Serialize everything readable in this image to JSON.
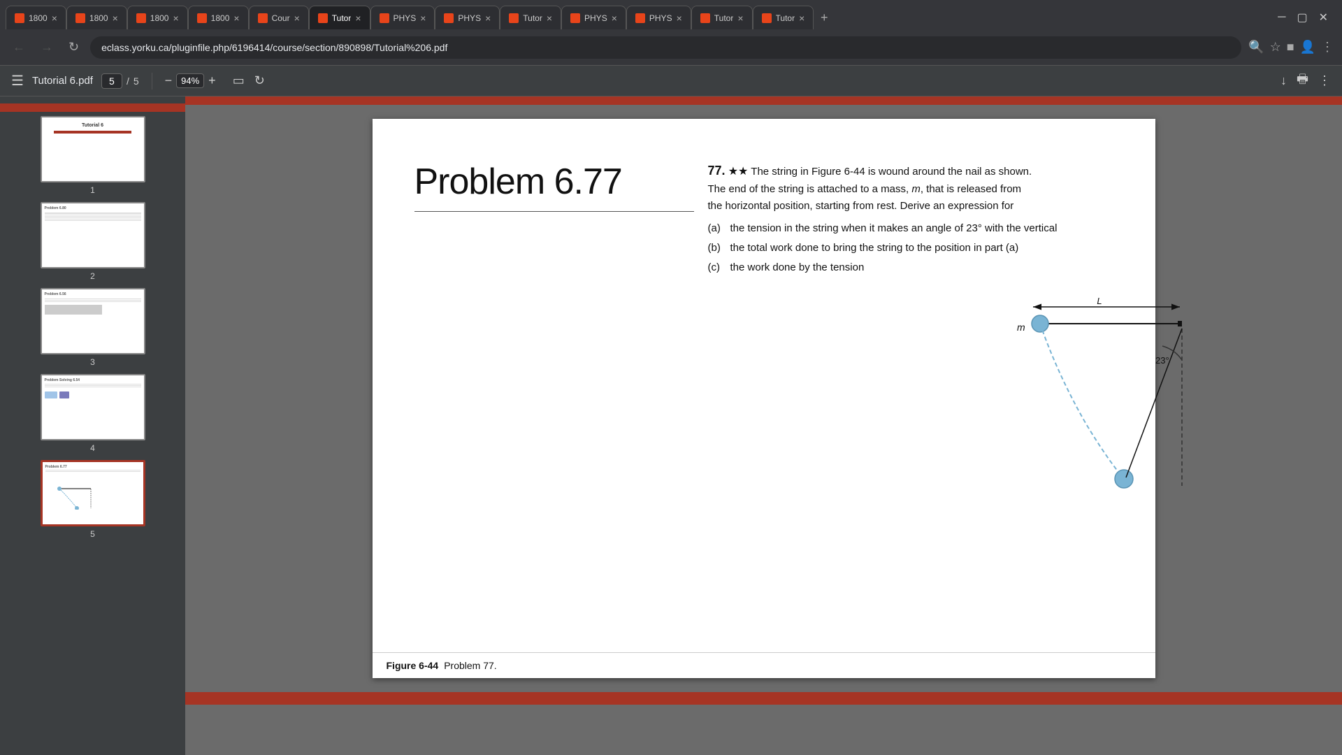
{
  "browser": {
    "tabs": [
      {
        "id": 1,
        "label": "1800",
        "active": false,
        "favicon": true
      },
      {
        "id": 2,
        "label": "1800",
        "active": false,
        "favicon": true
      },
      {
        "id": 3,
        "label": "1800",
        "active": false,
        "favicon": true
      },
      {
        "id": 4,
        "label": "1800",
        "active": false,
        "favicon": true
      },
      {
        "id": 5,
        "label": "Cour",
        "active": false,
        "favicon": true
      },
      {
        "id": 6,
        "label": "Tutor",
        "active": true,
        "favicon": true
      },
      {
        "id": 7,
        "label": "PHYS",
        "active": false,
        "favicon": true
      },
      {
        "id": 8,
        "label": "PHYS",
        "active": false,
        "favicon": true
      },
      {
        "id": 9,
        "label": "Tutor",
        "active": false,
        "favicon": true
      },
      {
        "id": 10,
        "label": "PHYS",
        "active": false,
        "favicon": true
      },
      {
        "id": 11,
        "label": "PHYS",
        "active": false,
        "favicon": true
      },
      {
        "id": 12,
        "label": "Tutor",
        "active": false,
        "favicon": true
      },
      {
        "id": 13,
        "label": "Tutor",
        "active": false,
        "favicon": true
      }
    ],
    "address": "eclass.yorku.ca/pluginfile.php/6196414/course/section/890898/Tutorial%206.pdf"
  },
  "toolbar": {
    "title": "Tutorial 6.pdf",
    "current_page": "5",
    "total_pages": "5",
    "zoom": "94%"
  },
  "thumbnails": [
    {
      "number": "1",
      "label": "Tutorial 6"
    },
    {
      "number": "2",
      "label": ""
    },
    {
      "number": "3",
      "label": ""
    },
    {
      "number": "4",
      "label": ""
    },
    {
      "number": "5",
      "label": "",
      "active": true
    }
  ],
  "pdf": {
    "problem_title": "Problem 6.77",
    "problem_number": "77.",
    "stars": "★★",
    "intro_text": "The string in Figure 6-44 is wound around the nail as shown. The end of the string is attached to a mass, m, that is released from the horizontal position, starting from rest. Derive an expression for",
    "parts": [
      {
        "label": "(a)",
        "text": "the tension in the string when it makes an angle of 23° with the vertical"
      },
      {
        "label": "(b)",
        "text": "the total work done to bring the string to the position in part (a)"
      },
      {
        "label": "(c)",
        "text": "the work done by the tension"
      }
    ],
    "figure_label": "Figure 6-44",
    "figure_caption": "Problem 77.",
    "angle_label": "23°",
    "L_label": "L",
    "m_label": "m"
  }
}
